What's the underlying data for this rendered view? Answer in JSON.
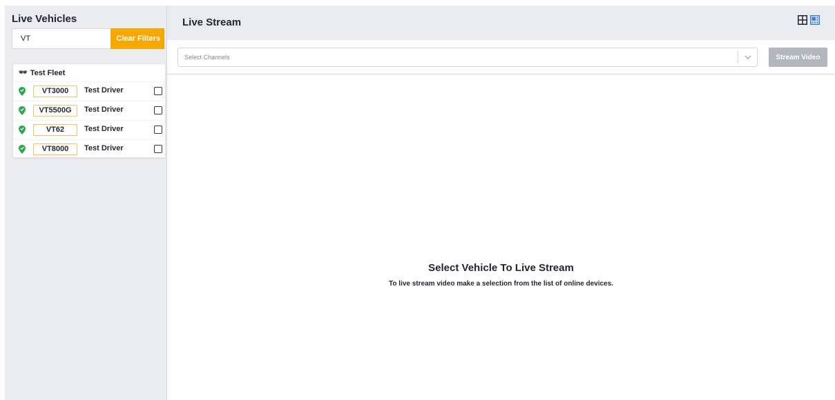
{
  "sidebar": {
    "title": "Live Vehicles",
    "search": {
      "value": "VT",
      "placeholder": ""
    },
    "clear_filters_label": "Clear Filters",
    "fleet": {
      "name": "Test Fleet",
      "vehicles": [
        {
          "id": "VT3000",
          "driver": "Test Driver",
          "status": "online",
          "checked": false
        },
        {
          "id": "VT5500G",
          "driver": "Test Driver",
          "status": "online",
          "checked": false
        },
        {
          "id": "VT62",
          "driver": "Test Driver",
          "status": "online",
          "checked": false
        },
        {
          "id": "VT8000",
          "driver": "Test Driver",
          "status": "online",
          "checked": false
        }
      ]
    }
  },
  "main": {
    "title": "Live Stream",
    "layout_icons": [
      "grid-2x2-icon",
      "grid-layout-icon"
    ],
    "channel_select_placeholder": "Select Channels",
    "stream_button_label": "Stream Video",
    "empty_state": {
      "title": "Select Vehicle To Live Stream",
      "subtitle": "To live stream video make a selection from the list of online devices."
    }
  },
  "colors": {
    "accent": "#f7a800",
    "online": "#2fa84f",
    "layout_icon_active": "#3c7bd6",
    "disabled_button": "#b2b6bd"
  }
}
